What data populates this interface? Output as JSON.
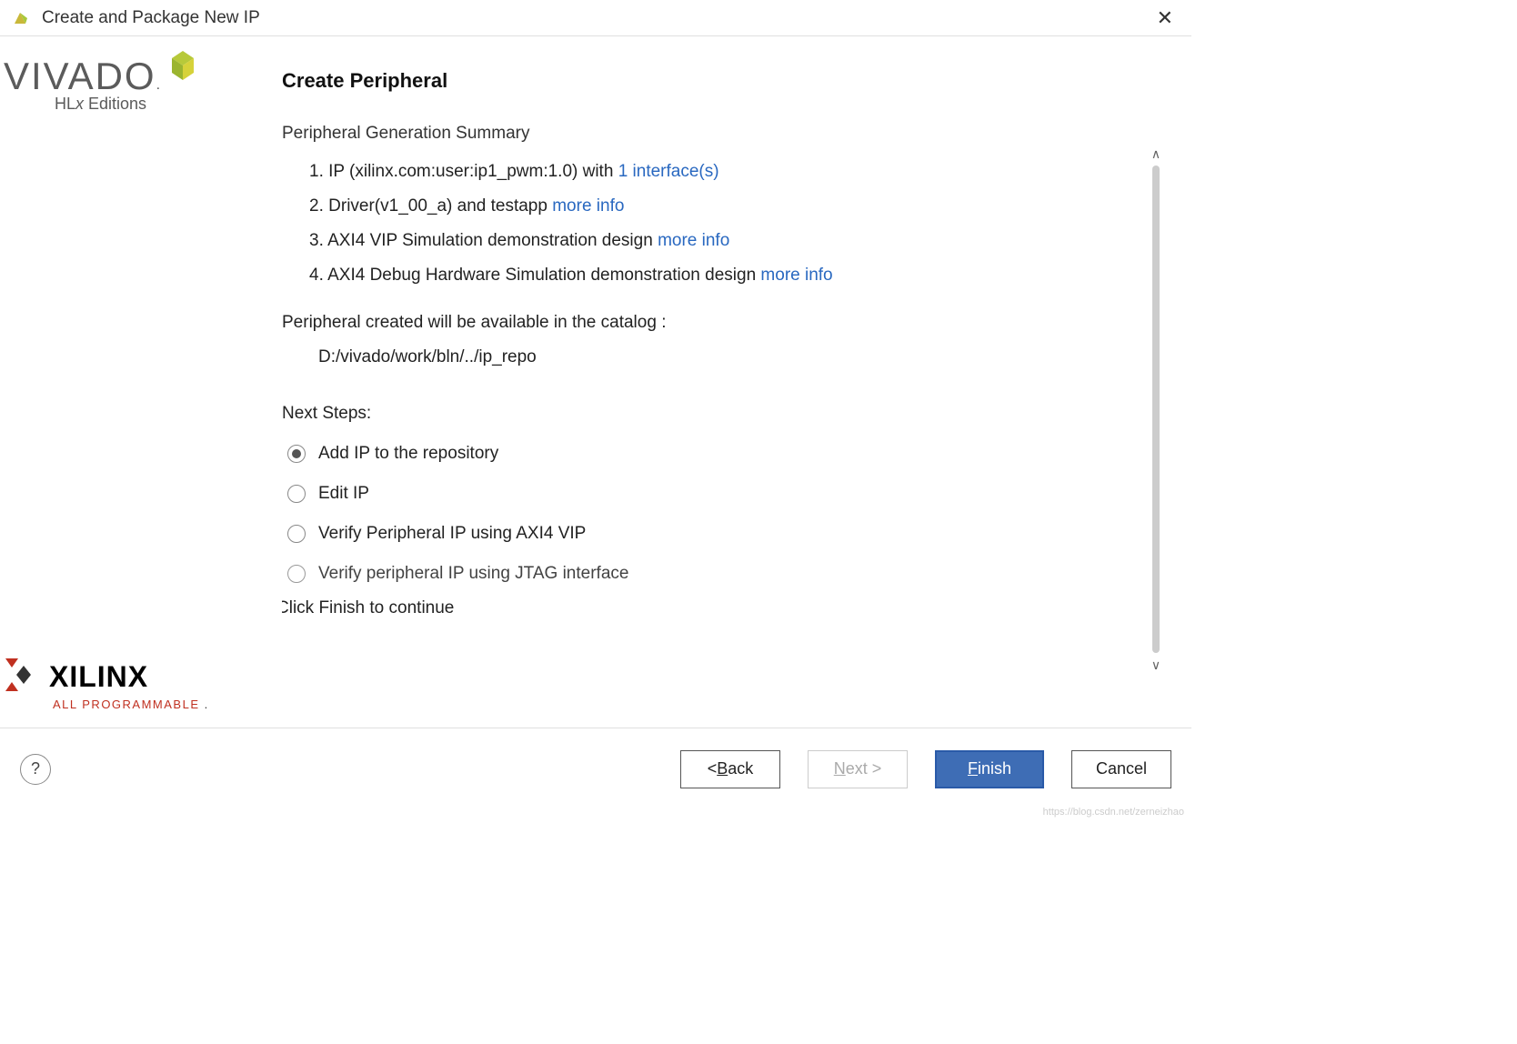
{
  "window": {
    "title": "Create and Package New IP"
  },
  "branding": {
    "vivado": "VIVADO",
    "hlx": "HLx Editions",
    "xilinx": "XILINX",
    "allprog": "ALL PROGRAMMABLE"
  },
  "page": {
    "heading": "Create Peripheral",
    "summaryHead": "Peripheral Generation Summary",
    "items": [
      {
        "num": "1.",
        "text": "IP (xilinx.com:user:ip1_pwm:1.0) with ",
        "link": "1 interface(s)"
      },
      {
        "num": "2.",
        "text": "Driver(v1_00_a) and testapp  ",
        "link": "more info"
      },
      {
        "num": "3.",
        "text": "AXI4 VIP Simulation demonstration design  ",
        "link": "more info"
      },
      {
        "num": "4.",
        "text": "AXI4 Debug Hardware Simulation demonstration design  ",
        "link": "more info"
      }
    ],
    "catalogText": "Peripheral created will be available in the catalog :",
    "catalogPath": "D:/vivado/work/bln/../ip_repo",
    "nextStepsHead": "Next Steps:",
    "radios": [
      {
        "label": "Add IP to the repository",
        "checked": true
      },
      {
        "label": "Edit IP",
        "checked": false
      },
      {
        "label": "Verify Peripheral IP using AXI4 VIP",
        "checked": false
      },
      {
        "label": "Verify peripheral IP using JTAG interface",
        "checked": false
      }
    ],
    "finishNote": "Click Finish to continue"
  },
  "footer": {
    "back": "< Back",
    "next": "Next >",
    "finish": "Finish",
    "cancel": "Cancel"
  },
  "watermark": "https://blog.csdn.net/zerneizhao"
}
